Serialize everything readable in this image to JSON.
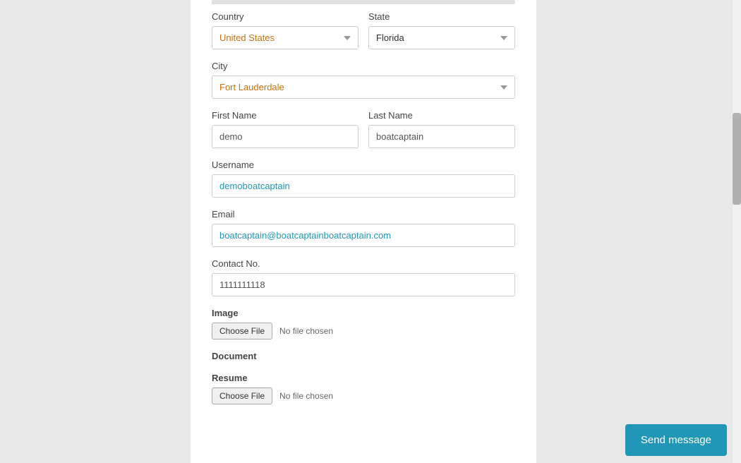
{
  "form": {
    "top_bar": "",
    "country_label": "Country",
    "state_label": "State",
    "city_label": "City",
    "first_name_label": "First Name",
    "last_name_label": "Last Name",
    "username_label": "Username",
    "email_label": "Email",
    "contact_label": "Contact No.",
    "image_label": "Image",
    "document_label": "Document",
    "resume_label": "Resume",
    "country_value": "United States",
    "state_value": "Florida",
    "city_value": "Fort Lauderdale",
    "first_name_value": "demo",
    "last_name_value": "boatcaptain",
    "username_value": "demoboatcaptain",
    "email_value": "boatcaptain@boatcaptainboatcaptain.com",
    "contact_value": "1111111118",
    "choose_file_label": "Choose File",
    "no_file_text": "No file chosen",
    "choose_file_label2": "Choose File",
    "no_file_text2": "No file chosen",
    "send_message_label": "Send message"
  }
}
